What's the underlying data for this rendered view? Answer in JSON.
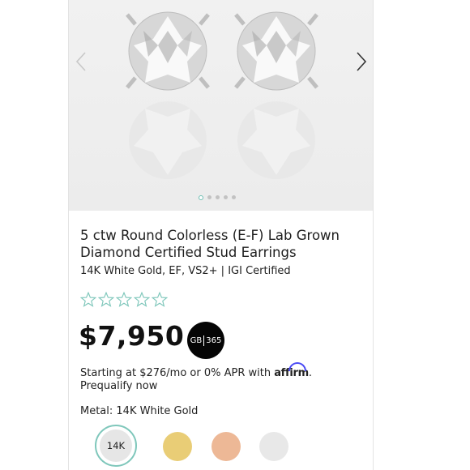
{
  "product": {
    "title": "5 ctw Round Colorless (E-F) Lab Grown Diamond Certified Stud Earrings",
    "subtitle": "14K White Gold, EF, VS2+ | IGI Certified",
    "rating_stars": 0,
    "rating_max": 5,
    "price": "$7,950",
    "badge_left": "GB",
    "badge_right": "365"
  },
  "financing": {
    "text_before": "Starting at $276/mo or 0% APR with ",
    "brand": "affirm",
    "text_after": ". ",
    "link": "Prequalify now"
  },
  "metal": {
    "label": "Metal: 14K White Gold",
    "swatches": [
      {
        "name": "14K",
        "color": "#e6e6e6",
        "selected": true
      },
      {
        "name": "yellow-gold",
        "color": "#e9cd76",
        "selected": false
      },
      {
        "name": "rose-gold",
        "color": "#edb896",
        "selected": false
      },
      {
        "name": "platinum",
        "color": "#e8e8e8",
        "selected": false
      }
    ]
  },
  "gallery": {
    "slide_count": 5,
    "active_slide": 1,
    "icons": [
      "chevron-left-icon",
      "chevron-right-icon"
    ]
  },
  "colors": {
    "accent": "#7fc7bb",
    "badge_bg": "#050505",
    "affirm": "#4a4af4"
  }
}
